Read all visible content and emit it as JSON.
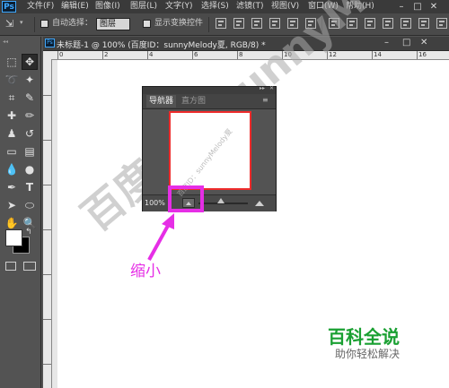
{
  "app": {
    "logo": "Ps"
  },
  "menu": [
    "文件(F)",
    "编辑(E)",
    "图像(I)",
    "图层(L)",
    "文字(Y)",
    "选择(S)",
    "滤镜(T)",
    "视图(V)",
    "窗口(W)",
    "帮助(H)"
  ],
  "window_controls": {
    "minimize": "–",
    "maximize": "□",
    "close": "✕"
  },
  "options_bar": {
    "auto_select_label": "自动选择：",
    "auto_select_value": "图层",
    "show_transform_label": "显示变换控件"
  },
  "document": {
    "tab_title": "未标题-1 @ 100% (百度ID：sunnyMelody夏, RGB/8) *",
    "icon_text": "Ps",
    "ruler_numbers": [
      "0",
      "2",
      "4",
      "6",
      "8",
      "10",
      "12",
      "14",
      "16"
    ]
  },
  "navigator": {
    "tabs": [
      "导航器",
      "直方图"
    ],
    "active_tab": "导航器",
    "zoom": "100%"
  },
  "annotation": {
    "label": "缩小",
    "color": "#e62ee6"
  },
  "watermark": {
    "text": "百度ID：sunnyMelody夏",
    "small": "百度ID：sunnyMelody夏"
  },
  "brand": {
    "title": "百科全说",
    "subtitle": "助你轻松解决",
    "color": "#1aa032"
  },
  "tools": [
    "move-tool",
    "marquee-tool",
    "lasso-tool",
    "magic-wand-tool",
    "crop-tool",
    "eyedropper-tool",
    "healing-brush-tool",
    "brush-tool",
    "clone-stamp-tool",
    "history-brush-tool",
    "eraser-tool",
    "gradient-tool",
    "blur-tool",
    "dodge-tool",
    "pen-tool",
    "type-tool",
    "path-selection-tool",
    "shape-tool",
    "hand-tool",
    "zoom-tool"
  ],
  "colors": {
    "foreground": "#ffffff",
    "background": "#000000"
  }
}
